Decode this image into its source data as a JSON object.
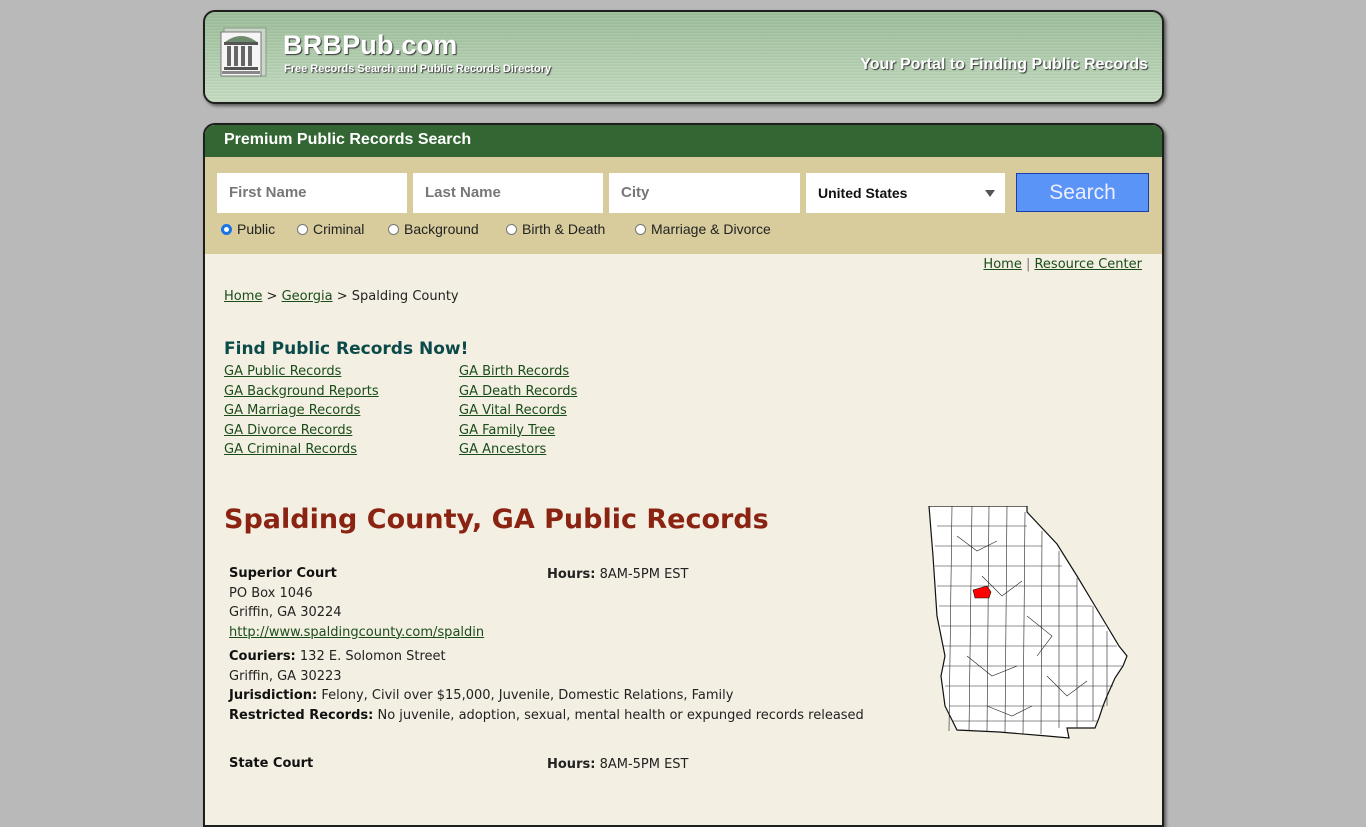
{
  "header": {
    "brand": "BRBPub.com",
    "subtitle": "Free Records Search and Public Records Directory",
    "portal_tagline": "Your Portal to Finding Public Records",
    "logo_icon": "courthouse-icon"
  },
  "search": {
    "title": "Premium Public Records Search",
    "first_name_placeholder": "First Name",
    "last_name_placeholder": "Last Name",
    "city_placeholder": "City",
    "country_selected": "United States",
    "search_button": "Search",
    "record_types": [
      {
        "label": "Public",
        "selected": true
      },
      {
        "label": "Criminal",
        "selected": false
      },
      {
        "label": "Background",
        "selected": false
      },
      {
        "label": "Birth & Death",
        "selected": false
      },
      {
        "label": "Marriage & Divorce",
        "selected": false
      }
    ],
    "colors": {
      "title_bar": "#336633",
      "panel": "#d8cc9d",
      "button": "#5b94f7"
    }
  },
  "top_links": {
    "home": "Home",
    "separator": "|",
    "resource_center": "Resource Center"
  },
  "breadcrumb": {
    "home": "Home",
    "sep": ">",
    "state": "Georgia",
    "current": "Spalding County"
  },
  "find": {
    "title": "Find Public Records Now!",
    "col1": [
      "GA Public Records",
      "GA Background Reports",
      "GA Marriage Records",
      "GA Divorce Records",
      "GA Criminal Records"
    ],
    "col2": [
      "GA Birth Records",
      "GA Death Records",
      "GA Vital Records",
      "GA Family Tree",
      "GA Ancestors"
    ]
  },
  "page_title": "Spalding County, GA Public Records",
  "records": [
    {
      "name": "Superior Court",
      "hours_label": "Hours:",
      "hours": "8AM-5PM EST",
      "address1": "PO Box 1046",
      "address2": "Griffin, GA 30224",
      "url": "http://www.spaldingcounty.com/spaldin",
      "couriers_label": "Couriers:",
      "couriers1": "132 E. Solomon Street",
      "couriers2": "Griffin, GA 30223",
      "jurisdiction_label": "Jurisdiction:",
      "jurisdiction": "Felony, Civil over $15,000, Juvenile, Domestic Relations, Family",
      "restricted_label": "Restricted Records:",
      "restricted": "No juvenile, adoption, sexual, mental health or expunged records released"
    },
    {
      "name": "State Court",
      "hours_label": "Hours:",
      "hours": "8AM-5PM EST"
    }
  ],
  "map": {
    "state": "Georgia",
    "highlight_county": "Spalding",
    "highlight_color": "#ff0000"
  }
}
